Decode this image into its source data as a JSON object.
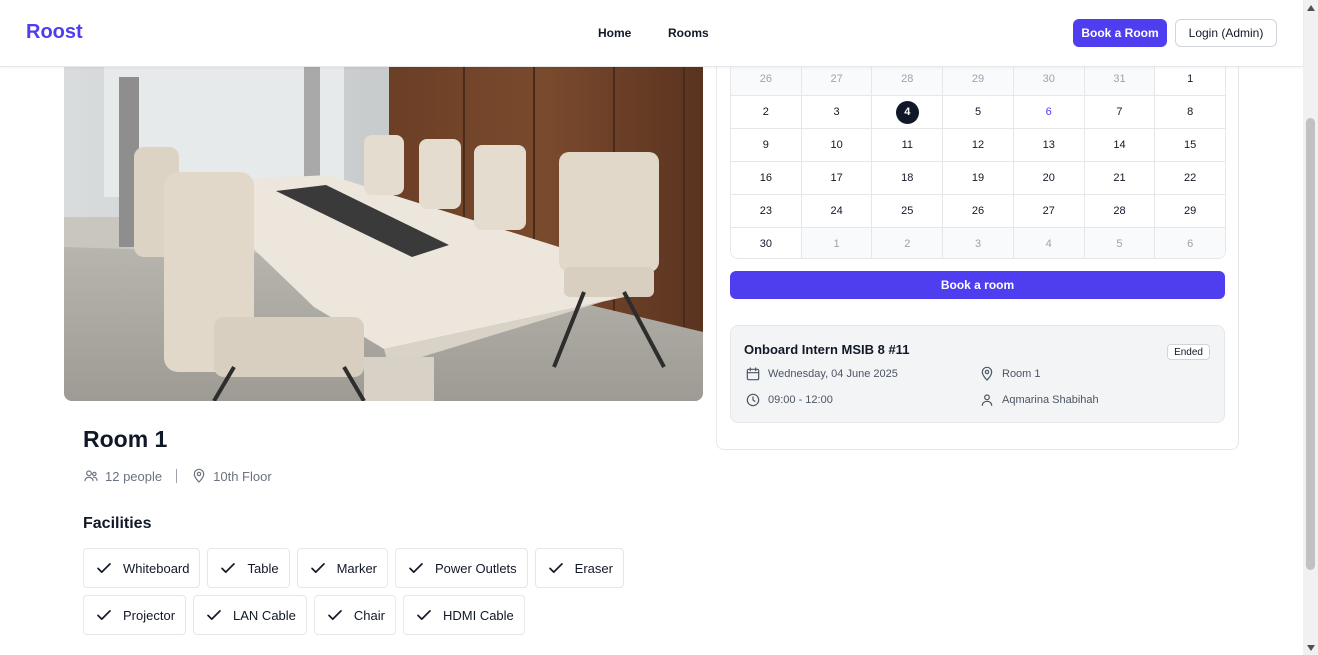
{
  "header": {
    "brand": "Roost",
    "nav": [
      "Home",
      "Rooms"
    ],
    "book_button": "Book a Room",
    "login_button": "Login (Admin)"
  },
  "room": {
    "title": "Room 1",
    "capacity": "12 people",
    "location": "10th Floor",
    "facilities_title": "Facilities",
    "facilities": [
      "Whiteboard",
      "Table",
      "Marker",
      "Power Outlets",
      "Eraser",
      "Projector",
      "LAN Cable",
      "Chair",
      "HDMI Cable"
    ]
  },
  "calendar": {
    "weeks": [
      [
        {
          "d": "26",
          "s": "muted"
        },
        {
          "d": "27",
          "s": "muted"
        },
        {
          "d": "28",
          "s": "muted"
        },
        {
          "d": "29",
          "s": "muted"
        },
        {
          "d": "30",
          "s": "muted"
        },
        {
          "d": "31",
          "s": "muted"
        },
        {
          "d": "1",
          "s": ""
        }
      ],
      [
        {
          "d": "2",
          "s": ""
        },
        {
          "d": "3",
          "s": ""
        },
        {
          "d": "4",
          "s": "today"
        },
        {
          "d": "5",
          "s": ""
        },
        {
          "d": "6",
          "s": "accent"
        },
        {
          "d": "7",
          "s": ""
        },
        {
          "d": "8",
          "s": ""
        }
      ],
      [
        {
          "d": "9",
          "s": ""
        },
        {
          "d": "10",
          "s": ""
        },
        {
          "d": "11",
          "s": ""
        },
        {
          "d": "12",
          "s": ""
        },
        {
          "d": "13",
          "s": ""
        },
        {
          "d": "14",
          "s": ""
        },
        {
          "d": "15",
          "s": ""
        }
      ],
      [
        {
          "d": "16",
          "s": ""
        },
        {
          "d": "17",
          "s": ""
        },
        {
          "d": "18",
          "s": ""
        },
        {
          "d": "19",
          "s": ""
        },
        {
          "d": "20",
          "s": ""
        },
        {
          "d": "21",
          "s": ""
        },
        {
          "d": "22",
          "s": ""
        }
      ],
      [
        {
          "d": "23",
          "s": ""
        },
        {
          "d": "24",
          "s": ""
        },
        {
          "d": "25",
          "s": ""
        },
        {
          "d": "26",
          "s": ""
        },
        {
          "d": "27",
          "s": ""
        },
        {
          "d": "28",
          "s": ""
        },
        {
          "d": "29",
          "s": ""
        }
      ],
      [
        {
          "d": "30",
          "s": ""
        },
        {
          "d": "1",
          "s": "muted"
        },
        {
          "d": "2",
          "s": "muted"
        },
        {
          "d": "3",
          "s": "muted"
        },
        {
          "d": "4",
          "s": "muted"
        },
        {
          "d": "5",
          "s": "muted"
        },
        {
          "d": "6",
          "s": "muted"
        }
      ]
    ],
    "book_button": "Book a room"
  },
  "event": {
    "title": "Onboard Intern MSIB 8 #11",
    "status": "Ended",
    "date": "Wednesday, 04 June 2025",
    "time": "09:00 - 12:00",
    "room": "Room 1",
    "organizer": "Aqmarina Shabihah"
  },
  "colors": {
    "accent": "#4f3df0",
    "text": "#111827",
    "muted": "#6b7280"
  },
  "icons": {
    "people": "users-icon",
    "location": "map-pin-icon",
    "check": "check-icon",
    "calendar": "calendar-icon",
    "clock": "clock-icon",
    "user": "user-icon"
  }
}
